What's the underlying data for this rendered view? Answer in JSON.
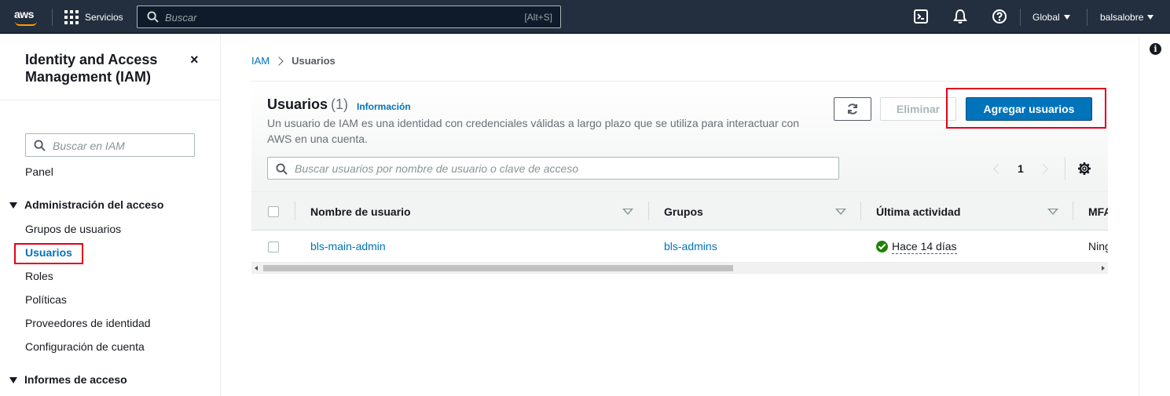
{
  "topnav": {
    "logo": "aws",
    "services_label": "Servicios",
    "search_placeholder": "Buscar",
    "search_shortcut": "[Alt+S]",
    "region_label": "Global",
    "user_label": "balsalobre",
    "icons": [
      "cloudshell-icon",
      "bell-icon",
      "help-icon"
    ]
  },
  "sidebar": {
    "title": "Identity and Access Management (IAM)",
    "close_icon": "×",
    "search_placeholder": "Buscar en IAM",
    "panel_link": "Panel",
    "section_access": "Administración del acceso",
    "items": [
      {
        "label": "Grupos de usuarios"
      },
      {
        "label": "Usuarios",
        "active": true
      },
      {
        "label": "Roles"
      },
      {
        "label": "Políticas"
      },
      {
        "label": "Proveedores de identidad"
      },
      {
        "label": "Configuración de cuenta"
      }
    ],
    "section_reports": "Informes de acceso"
  },
  "breadcrumb": {
    "root": "IAM",
    "current": "Usuarios"
  },
  "users": {
    "title": "Usuarios",
    "count": "(1)",
    "info_link": "Información",
    "description": "Un usuario de IAM es una identidad con credenciales válidas a largo plazo que se utiliza para interactuar con AWS en una cuenta.",
    "delete_button": "Eliminar",
    "add_button": "Agregar usuarios",
    "search_placeholder": "Buscar usuarios por nombre de usuario o clave de acceso",
    "page_number": "1",
    "columns": [
      "Nombre de usuario",
      "Grupos",
      "Última actividad",
      "MFA"
    ],
    "rows": [
      {
        "name": "bls-main-admin",
        "groups": "bls-admins",
        "last_activity": "Hace 14 días",
        "mfa": "Ninguno"
      }
    ]
  },
  "colors": {
    "nav_bg": "#232f3e",
    "accent": "#0073bb",
    "highlight": "#e3001b",
    "success": "#1d8102"
  }
}
